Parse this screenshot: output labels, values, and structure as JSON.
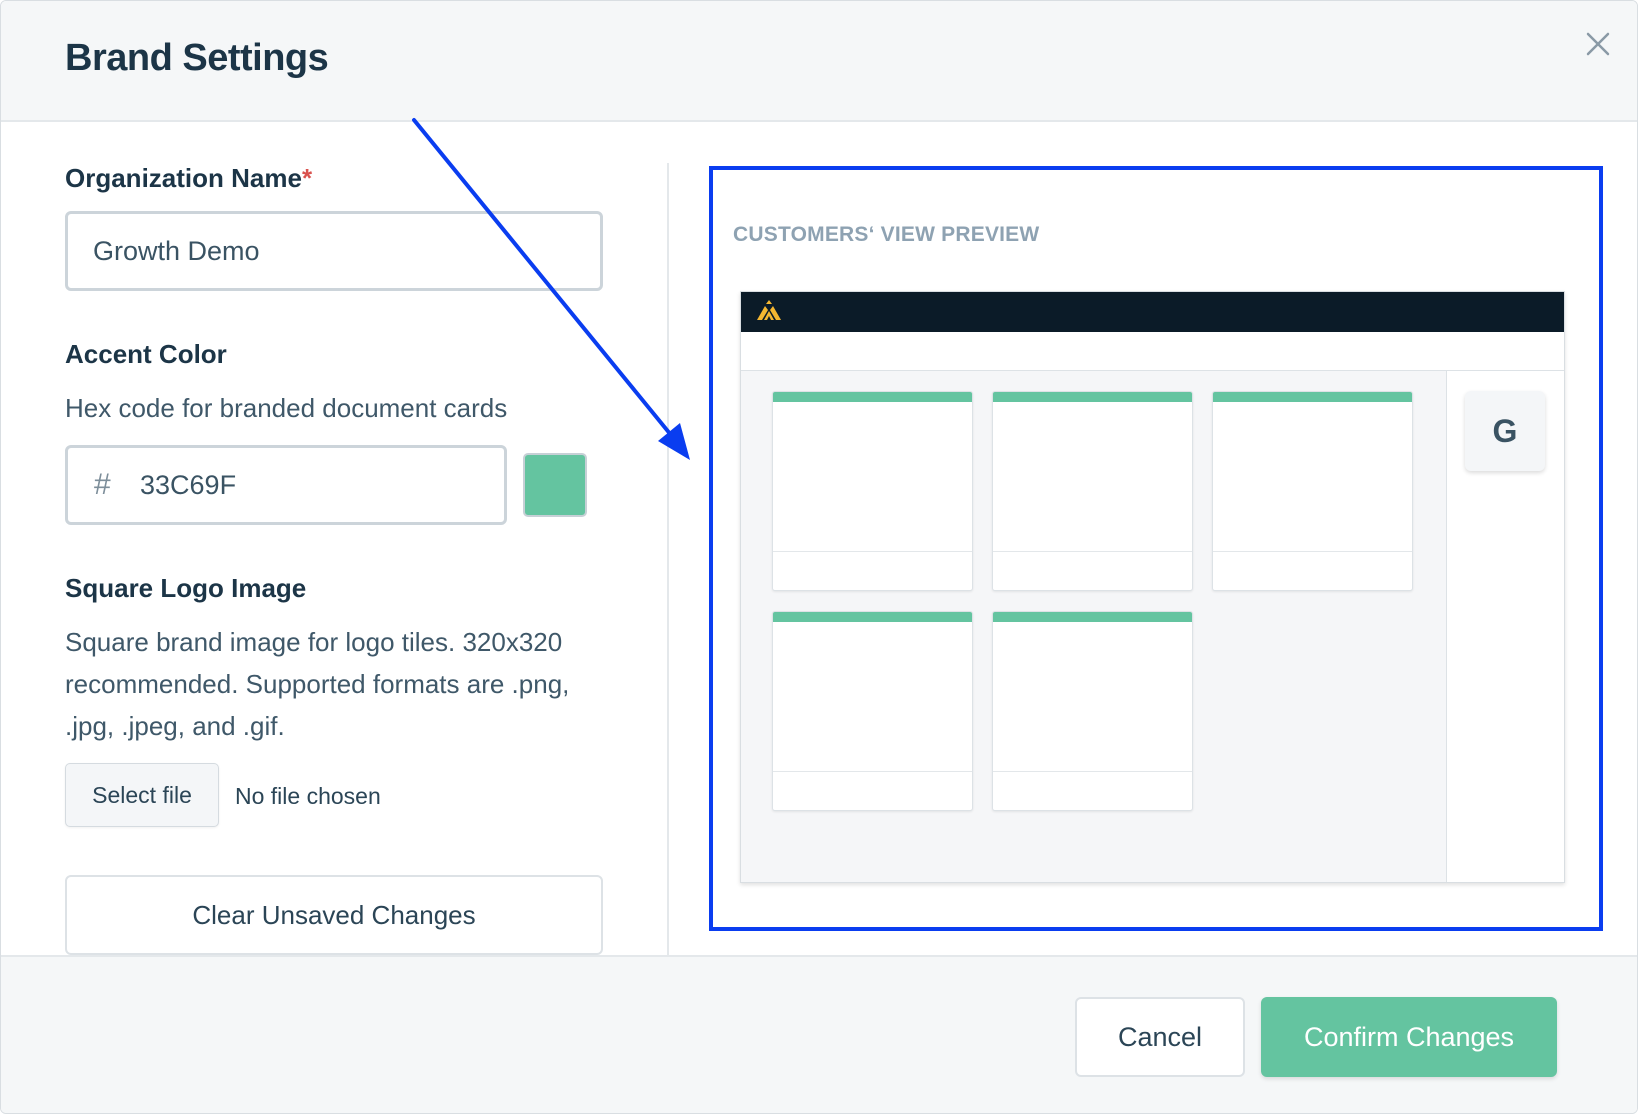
{
  "modal": {
    "title": "Brand Settings",
    "close_icon": "close-icon"
  },
  "form": {
    "org_name": {
      "label": "Organization Name",
      "required_mark": "*",
      "value": "Growth Demo"
    },
    "accent_color": {
      "label": "Accent Color",
      "helper": "Hex code for branded document cards",
      "prefix": "#",
      "value": "33C69F",
      "swatch_color": "#64C4A0"
    },
    "logo": {
      "label": "Square Logo Image",
      "helper": "Square brand image for logo tiles. 320x320 recommended. Supported formats are .png, .jpg, .jpeg, and .gif.",
      "button_label": "Select file",
      "file_status": "No file chosen"
    },
    "clear_button": "Clear Unsaved Changes"
  },
  "preview": {
    "heading": "CUSTOMERS‘ VIEW PREVIEW",
    "logo_icon": "brand-logo-icon",
    "avatar_initial": "G",
    "card_accent_color": "#64C4A0",
    "cards": [
      {},
      {},
      {},
      {},
      {}
    ]
  },
  "annotation": {
    "frame_color": "#0A3DF0",
    "arrow_icon": "annotation-arrow-icon"
  },
  "footer": {
    "cancel_label": "Cancel",
    "confirm_label": "Confirm Changes"
  },
  "colors": {
    "accent": "#64C4A0",
    "title": "#1C3547",
    "annotation": "#0A3DF0"
  }
}
